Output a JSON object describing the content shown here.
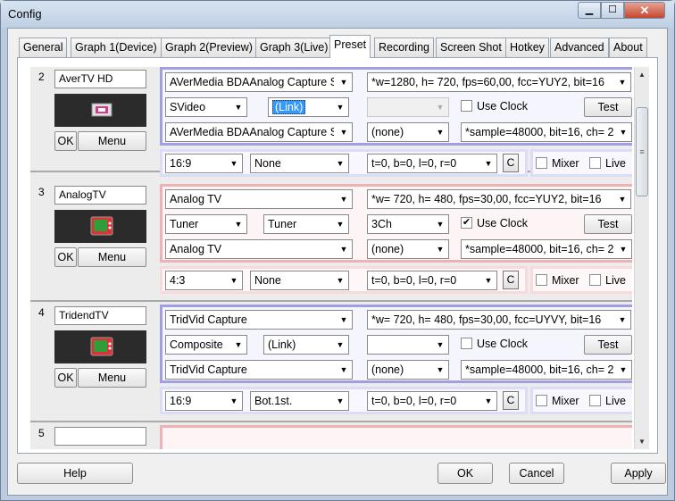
{
  "window": {
    "title": "Config",
    "close_glyph": "✕"
  },
  "tabs": [
    "General",
    "Graph 1(Device)",
    "Graph 2(Preview)",
    "Graph 3(Live)",
    "Preset",
    "Recording",
    "Screen Shot",
    "Hotkey",
    "Advanced",
    "About"
  ],
  "active_tab": "Preset",
  "rows": [
    {
      "num": "2",
      "name": "AverTV HD",
      "ok": "OK",
      "menu": "Menu",
      "video_device": "AVerMedia BDAAnalog Capture Se",
      "video_format": "*w=1280, h= 720, fps=60,00,  fcc=YUY2, bit=16",
      "input": "SVideo",
      "crossbar": "(Link)",
      "channel": "",
      "use_clock": "Use Clock",
      "use_clock_checked": false,
      "test": "Test",
      "audio_device": "AVerMedia BDAAnalog Capture Se",
      "audio_src": "(none)",
      "audio_format": "*sample=48000, bit=16, ch= 2",
      "aspect": "16:9",
      "deinterlace": "None",
      "crop": "t=0, b=0, l=0, r=0",
      "c": "C",
      "mixer": "Mixer",
      "live": "Live",
      "color": "blue"
    },
    {
      "num": "3",
      "name": "AnalogTV",
      "ok": "OK",
      "menu": "Menu",
      "video_device": "Analog TV",
      "video_format": "*w= 720, h= 480, fps=30,00,  fcc=YUY2, bit=16",
      "input": "Tuner",
      "crossbar": "Tuner",
      "channel": "3Ch",
      "use_clock": "Use Clock",
      "use_clock_checked": true,
      "test": "Test",
      "audio_device": "Analog TV",
      "audio_src": "(none)",
      "audio_format": "*sample=48000, bit=16, ch= 2",
      "aspect": "4:3",
      "deinterlace": "None",
      "crop": "t=0, b=0, l=0, r=0",
      "c": "C",
      "mixer": "Mixer",
      "live": "Live",
      "color": "red"
    },
    {
      "num": "4",
      "name": "TridendTV",
      "ok": "OK",
      "menu": "Menu",
      "video_device": "TridVid Capture",
      "video_format": "*w= 720, h= 480, fps=30,00,  fcc=UYVY, bit=16",
      "input": "Composite",
      "crossbar": "(Link)",
      "channel": "",
      "use_clock": "Use Clock",
      "use_clock_checked": false,
      "test": "Test",
      "audio_device": "TridVid Capture",
      "audio_src": "(none)",
      "audio_format": "*sample=48000, bit=16, ch= 2",
      "aspect": "16:9",
      "deinterlace": "Bot.1st.",
      "crop": "t=0, b=0, l=0, r=0",
      "c": "C",
      "mixer": "Mixer",
      "live": "Live",
      "color": "blue"
    }
  ],
  "partial_row_num": "5",
  "footer": {
    "help": "Help",
    "ok": "OK",
    "cancel": "Cancel",
    "apply": "Apply"
  },
  "colors": {
    "blue_group": "#9f9fe3",
    "red_group": "#f0b1b5",
    "selection": "#3399ff"
  }
}
